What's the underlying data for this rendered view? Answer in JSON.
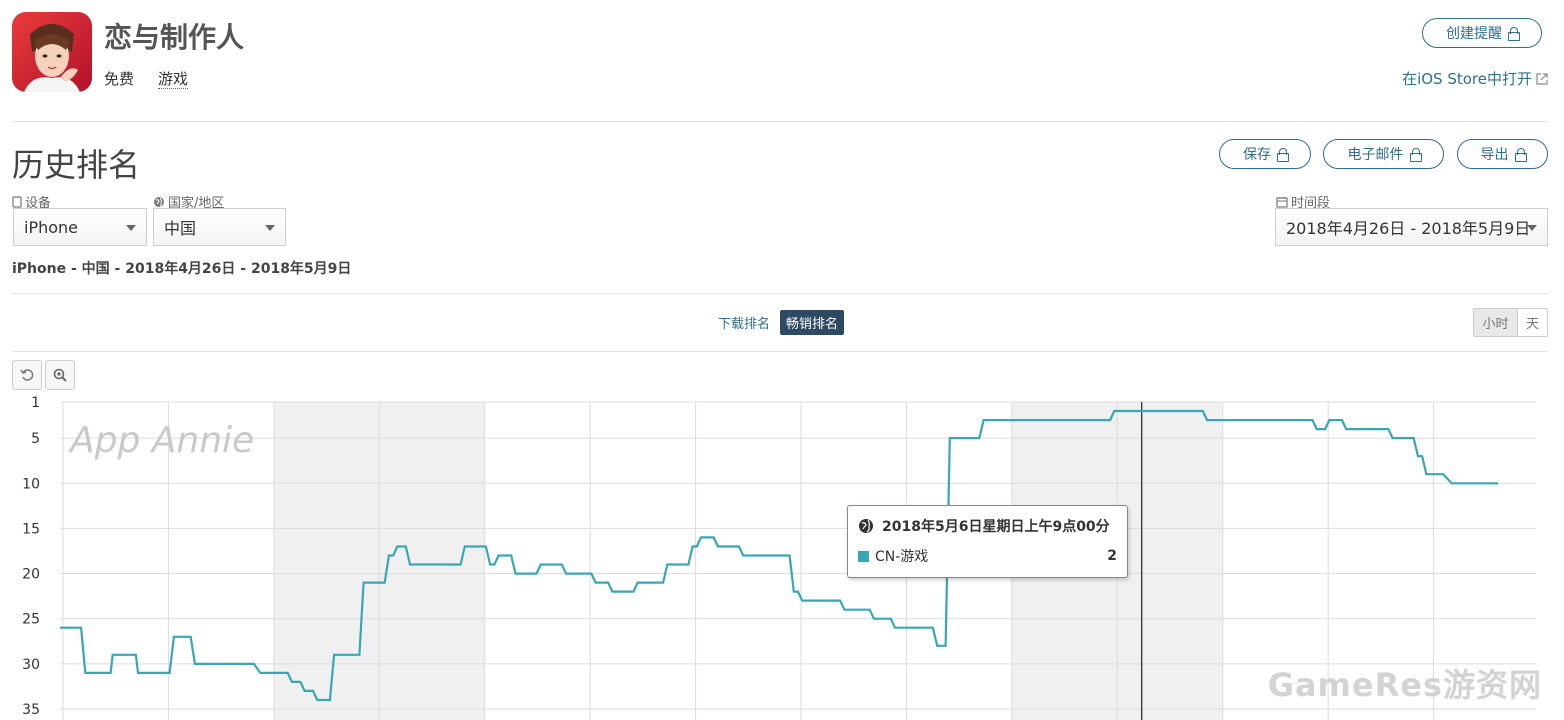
{
  "app": {
    "name": "恋与制作人",
    "price": "免费",
    "category": "游戏",
    "create_alert_label": "创建提醒",
    "open_ios_store_label": "在iOS Store中打开"
  },
  "page": {
    "title": "历史排名",
    "actions": {
      "save": "保存",
      "email": "电子邮件",
      "export": "导出"
    }
  },
  "filters": {
    "device_label": "设备",
    "device_value": "iPhone",
    "country_label": "国家/地区",
    "country_value": "中国",
    "period_label": "时间段",
    "period_value": "2018年4月26日 - 2018年5月9日"
  },
  "summary": "iPhone - 中国 - 2018年4月26日 - 2018年5月9日",
  "rank_tabs": {
    "download": "下载排名",
    "grossing": "畅销排名",
    "active": "grossing"
  },
  "granularity": {
    "hour": "小时",
    "day": "天",
    "active": "hour"
  },
  "watermarks": {
    "chart": "App Annie",
    "site": "GameRes游资网"
  },
  "tooltip": {
    "date": "2018年5月6日星期日上午9点00分",
    "series": "CN-游戏",
    "value": "2",
    "color": "#3aa6b5"
  },
  "chart_data": {
    "type": "line",
    "y_inverted": true,
    "yticks": [
      1,
      5,
      10,
      15,
      20,
      25,
      30,
      35
    ],
    "ylim": [
      1,
      35
    ],
    "series": [
      {
        "name": "CN-游戏",
        "color": "#3aa6b5",
        "points": [
          [
            0.0,
            26
          ],
          [
            0.1,
            26
          ],
          [
            0.12,
            31
          ],
          [
            0.24,
            31
          ],
          [
            0.25,
            29
          ],
          [
            0.36,
            29
          ],
          [
            0.37,
            31
          ],
          [
            0.52,
            31
          ],
          [
            0.54,
            27
          ],
          [
            0.62,
            27
          ],
          [
            0.64,
            30
          ],
          [
            0.92,
            30
          ],
          [
            0.95,
            31
          ],
          [
            1.08,
            31
          ],
          [
            1.1,
            32
          ],
          [
            1.14,
            32
          ],
          [
            1.16,
            33
          ],
          [
            1.2,
            33
          ],
          [
            1.22,
            34
          ],
          [
            1.28,
            34
          ],
          [
            1.3,
            29
          ],
          [
            1.42,
            29
          ],
          [
            1.44,
            21
          ],
          [
            1.54,
            21
          ],
          [
            1.56,
            18
          ],
          [
            1.58,
            18
          ],
          [
            1.6,
            17
          ],
          [
            1.64,
            17
          ],
          [
            1.66,
            19
          ],
          [
            1.9,
            19
          ],
          [
            1.92,
            17
          ],
          [
            2.02,
            17
          ],
          [
            2.04,
            19
          ],
          [
            2.06,
            19
          ],
          [
            2.08,
            18
          ],
          [
            2.14,
            18
          ],
          [
            2.16,
            20
          ],
          [
            2.26,
            20
          ],
          [
            2.28,
            19
          ],
          [
            2.38,
            19
          ],
          [
            2.4,
            20
          ],
          [
            2.52,
            20
          ],
          [
            2.54,
            21
          ],
          [
            2.6,
            21
          ],
          [
            2.62,
            22
          ],
          [
            2.72,
            22
          ],
          [
            2.74,
            21
          ],
          [
            2.86,
            21
          ],
          [
            2.88,
            19
          ],
          [
            2.98,
            19
          ],
          [
            3.0,
            17
          ],
          [
            3.02,
            17
          ],
          [
            3.04,
            16
          ],
          [
            3.1,
            16
          ],
          [
            3.12,
            17
          ],
          [
            3.22,
            17
          ],
          [
            3.24,
            18
          ],
          [
            3.46,
            18
          ],
          [
            3.48,
            22
          ],
          [
            3.5,
            22
          ],
          [
            3.52,
            23
          ],
          [
            3.7,
            23
          ],
          [
            3.72,
            24
          ],
          [
            3.84,
            24
          ],
          [
            3.86,
            25
          ],
          [
            3.94,
            25
          ],
          [
            3.96,
            26
          ],
          [
            4.14,
            26
          ],
          [
            4.16,
            28
          ],
          [
            4.2,
            28
          ],
          [
            4.22,
            5
          ],
          [
            4.36,
            5
          ],
          [
            4.38,
            3
          ],
          [
            4.98,
            3
          ],
          [
            5.0,
            2
          ],
          [
            5.42,
            2
          ],
          [
            5.44,
            3
          ],
          [
            5.94,
            3
          ],
          [
            5.96,
            4
          ],
          [
            6.0,
            4
          ],
          [
            6.02,
            3
          ],
          [
            6.08,
            3
          ],
          [
            6.1,
            4
          ],
          [
            6.3,
            4
          ],
          [
            6.32,
            5
          ],
          [
            6.42,
            5
          ],
          [
            6.44,
            7
          ],
          [
            6.46,
            7
          ],
          [
            6.48,
            9
          ],
          [
            6.56,
            9
          ],
          [
            6.6,
            10
          ],
          [
            6.82,
            10
          ]
        ]
      }
    ],
    "cursor_x": 5.13,
    "weekend_bands": [
      [
        1.0,
        2.0
      ],
      [
        4.5,
        5.5
      ]
    ],
    "x_days": 7
  }
}
